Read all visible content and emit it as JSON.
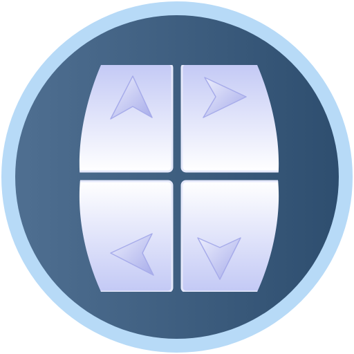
{
  "icon": {
    "name": "four-direction-pad-icon",
    "colors": {
      "ring": "#b7daf7",
      "disc_left": "#4f6f91",
      "disc_right": "#2e4e6f",
      "tile_top": "#c3c9f5",
      "tile_bottom": "#ffffff",
      "tile_edge": "#e6e9fb",
      "arrow_light": "#eceefd",
      "arrow_dark": "#a7acea"
    },
    "buttons": [
      {
        "id": "top-left",
        "arrow": "up"
      },
      {
        "id": "top-right",
        "arrow": "right"
      },
      {
        "id": "bottom-left",
        "arrow": "left"
      },
      {
        "id": "bottom-right",
        "arrow": "down"
      }
    ]
  }
}
